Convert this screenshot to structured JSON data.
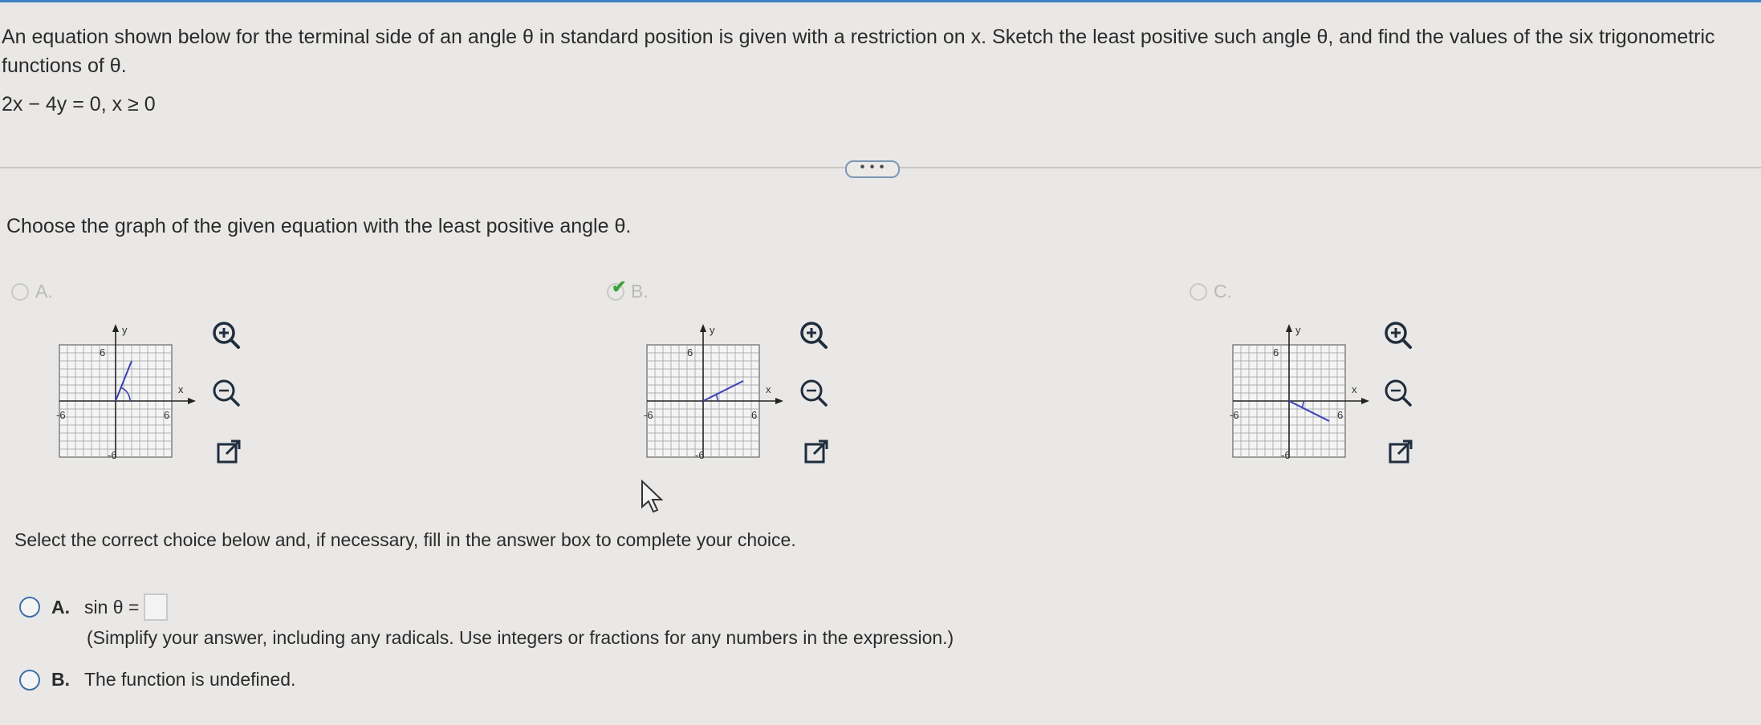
{
  "question": {
    "text": "An equation shown below for the terminal side of an angle θ in standard position is given with a restriction on x. Sketch the least positive such angle θ, and find the values of the six trigonometric functions of θ.",
    "equation": "2x − 4y = 0, x ≥ 0"
  },
  "more_button": "• • •",
  "prompt": "Choose the graph of the given equation with the least positive angle θ.",
  "graph_options": [
    {
      "letter": "A.",
      "selected": false,
      "y_label": "y",
      "x_label": "x",
      "tick_pos": "6",
      "tick_neg": "-6",
      "line_end": [
        2,
        5
      ]
    },
    {
      "letter": "B.",
      "selected": true,
      "y_label": "y",
      "x_label": "x",
      "tick_pos": "6",
      "tick_neg": "-6",
      "line_end": [
        5,
        2.5
      ]
    },
    {
      "letter": "C.",
      "selected": false,
      "y_label": "y",
      "x_label": "x",
      "tick_pos": "6",
      "tick_neg": "-6",
      "line_end": [
        5,
        -2.5
      ]
    }
  ],
  "icons": [
    "zoom-in-icon",
    "zoom-out-icon",
    "open-new-window-icon",
    "mouse-cursor-icon"
  ],
  "select_prompt": "Select the correct choice below and, if necessary, fill in the answer box to complete your choice.",
  "choices": {
    "a": {
      "letter": "A.",
      "label": "sin θ =",
      "hint": "(Simplify your answer, including any radicals. Use integers or fractions for any numbers in the expression.)"
    },
    "b": {
      "letter": "B.",
      "label": "The function is undefined."
    }
  },
  "colors": {
    "accent": "#3f6fa8",
    "line": "#3b3fb5",
    "check": "#3aa33a"
  }
}
